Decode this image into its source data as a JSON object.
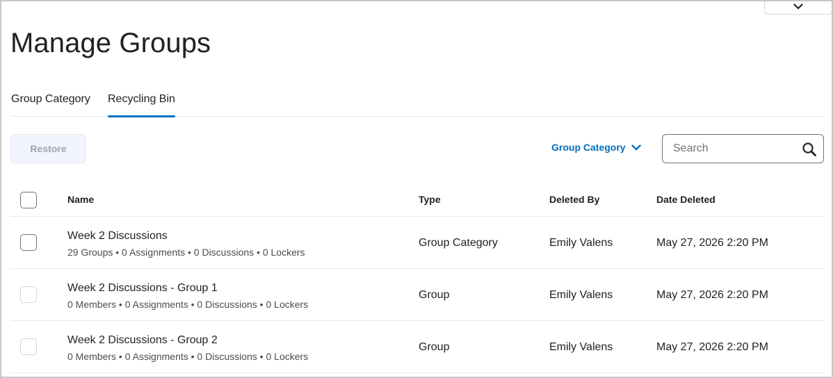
{
  "page": {
    "title": "Manage Groups"
  },
  "tabs": [
    {
      "label": "Group Category",
      "active": false
    },
    {
      "label": "Recycling Bin",
      "active": true
    }
  ],
  "toolbar": {
    "restore_label": "Restore",
    "filter_label": "Group Category",
    "search_placeholder": "Search"
  },
  "table": {
    "headers": {
      "name": "Name",
      "type": "Type",
      "deleted_by": "Deleted By",
      "date_deleted": "Date Deleted"
    },
    "rows": [
      {
        "name": "Week 2 Discussions",
        "details": "29 Groups • 0 Assignments • 0 Discussions • 0 Lockers",
        "type": "Group Category",
        "deleted_by": "Emily Valens",
        "date_deleted": "May 27, 2026 2:20 PM"
      },
      {
        "name": "Week 2 Discussions - Group 1",
        "details": "0 Members • 0 Assignments • 0 Discussions • 0 Lockers",
        "type": "Group",
        "deleted_by": "Emily Valens",
        "date_deleted": "May 27, 2026 2:20 PM"
      },
      {
        "name": "Week 2 Discussions - Group 2",
        "details": "0 Members • 0 Assignments • 0 Discussions • 0 Lockers",
        "type": "Group",
        "deleted_by": "Emily Valens",
        "date_deleted": "May 27, 2026 2:20 PM"
      }
    ]
  },
  "colors": {
    "accent": "#006fbf",
    "text": "#202122",
    "muted": "#494c4e",
    "divider": "#e3e9f1"
  },
  "icons": {
    "top_toggle": "chevron-down-icon",
    "filter": "chevron-down-icon",
    "search": "search-icon"
  }
}
